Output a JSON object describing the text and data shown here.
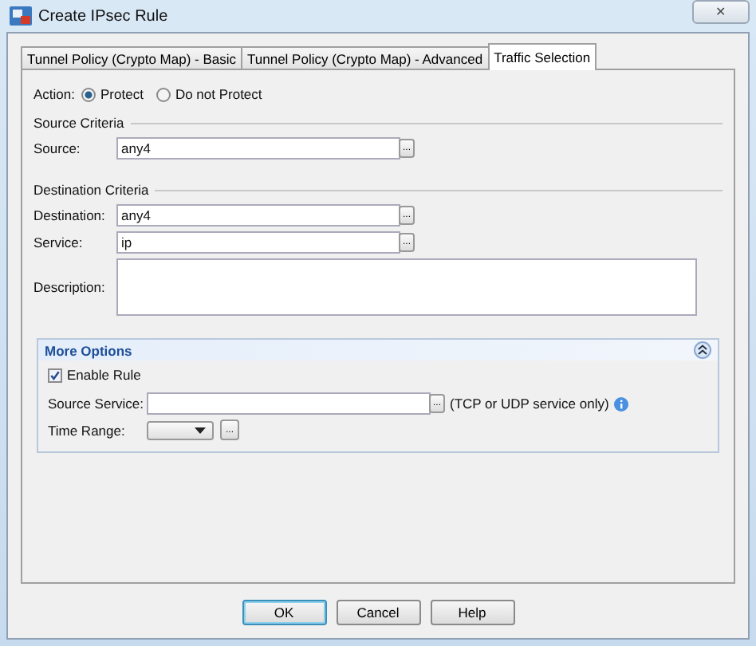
{
  "window": {
    "title": "Create IPsec Rule",
    "close": "✕"
  },
  "tabs": [
    {
      "label": "Tunnel Policy (Crypto Map) - Basic",
      "selected": false
    },
    {
      "label": "Tunnel Policy (Crypto Map) - Advanced",
      "selected": false
    },
    {
      "label": "Traffic Selection",
      "selected": true
    }
  ],
  "action": {
    "label": "Action:",
    "options": [
      {
        "label": "Protect",
        "selected": true
      },
      {
        "label": "Do not Protect",
        "selected": false
      }
    ]
  },
  "source_criteria": {
    "heading": "Source Criteria",
    "source": {
      "label": "Source:",
      "value": "any4",
      "browse": "..."
    }
  },
  "destination_criteria": {
    "heading": "Destination Criteria",
    "destination": {
      "label": "Destination:",
      "value": "any4",
      "browse": "..."
    },
    "service": {
      "label": "Service:",
      "value": "ip",
      "browse": "..."
    },
    "description": {
      "label": "Description:"
    }
  },
  "more_options": {
    "heading": "More Options",
    "expanded": true,
    "enable_rule": {
      "label": "Enable Rule",
      "checked": true
    },
    "source_service": {
      "label": "Source Service:",
      "browse": "...",
      "note": "(TCP or UDP service only)"
    },
    "time_range": {
      "label": "Time Range:",
      "browse": "..."
    }
  },
  "buttons": [
    "OK",
    "Cancel",
    "Help"
  ]
}
